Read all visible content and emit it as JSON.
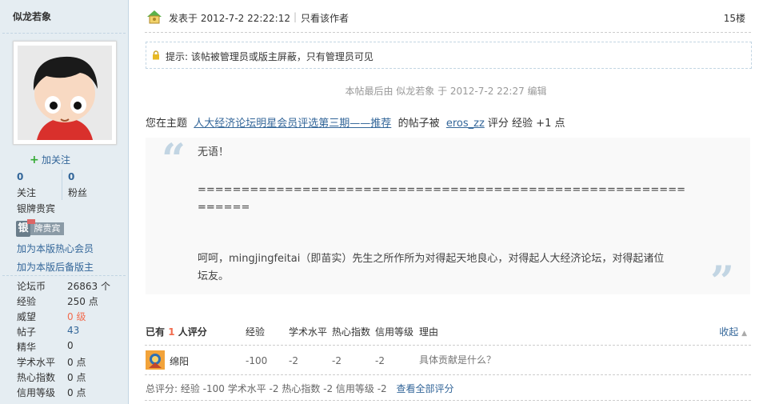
{
  "author": {
    "name": "似龙若象",
    "follow_label": "加关注",
    "following_count": "0",
    "following_label": "关注",
    "fans_count": "0",
    "fans_label": "粉丝",
    "rank": "银牌贵宾",
    "badge_char": "银",
    "badge_text": "牌贵宾",
    "links": [
      "加为本版热心会员",
      "加为本版后备版主"
    ],
    "profile": [
      {
        "label": "论坛币",
        "value": "26863 个"
      },
      {
        "label": "经验",
        "value": "250 点"
      },
      {
        "label": "威望",
        "value": "0 级"
      },
      {
        "label": "帖子",
        "value": "43"
      },
      {
        "label": "精华",
        "value": "0"
      },
      {
        "label": "学术水平",
        "value": "0 点"
      },
      {
        "label": "热心指数",
        "value": "0 点"
      },
      {
        "label": "信用等级",
        "value": "0 点"
      }
    ]
  },
  "post": {
    "posted_at": "发表于  2012-7-2 22:22:12",
    "separator": "|",
    "only_author": "只看该作者",
    "floor": "15楼",
    "notice": "提示: 该帖被管理员或版主屏蔽，只有管理员可见",
    "edited": "本帖最后由  似龙若象  于  2012-7-2 22:27 编辑",
    "rate_prefix": "您在主题",
    "rate_topic": "人大经济论坛明星会员评选第三期——推荐",
    "rate_mid": "的帖子被",
    "rate_user": "eros_zz",
    "rate_suffix": "评分  经验  +1 点",
    "quote_open": "“",
    "quote_close": "”",
    "quote_lines": [
      "无语！",
      "==============================================================",
      "==",
      "呵呵，mingjingfeitai（即苗实）先生之所作所为对得起天地良心，对得起人大经济论坛，对得起诸位",
      "坛友。"
    ]
  },
  "ratelog": {
    "prefix": "已有",
    "count": "1",
    "suffix": "人评分",
    "columns": [
      "经验",
      "学术水平",
      "热心指数",
      "信用等级",
      "理由"
    ],
    "collapse": "收起",
    "rows": [
      {
        "user": "绵阳",
        "values": [
          "-100",
          "-2",
          "-2",
          "-2"
        ],
        "reason": "具体贡献是什么？"
      }
    ],
    "total_text": "总评分: 经验  -100  学术水平  -2  热心指数  -2  信用等级  -2",
    "view_all": "查看全部评分"
  },
  "colors": {
    "sidebar_bg": "#E5EDF2",
    "link": "#336699",
    "accent": "#F26C4F"
  }
}
